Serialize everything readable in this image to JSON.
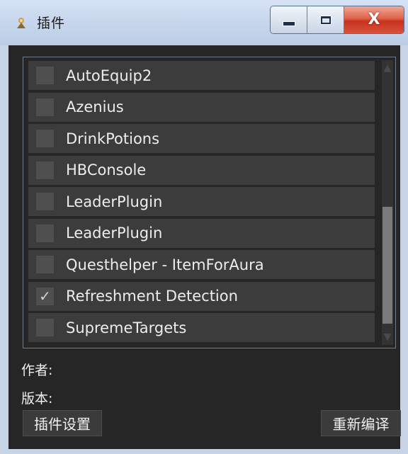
{
  "window": {
    "title": "插件",
    "close_label": "X"
  },
  "plugins": [
    {
      "label": "AutoEquip2",
      "checked": false
    },
    {
      "label": "Azenius",
      "checked": false
    },
    {
      "label": "DrinkPotions",
      "checked": false
    },
    {
      "label": "HBConsole",
      "checked": false
    },
    {
      "label": "LeaderPlugin",
      "checked": false
    },
    {
      "label": "LeaderPlugin",
      "checked": false
    },
    {
      "label": "Questhelper - ItemForAura",
      "checked": false
    },
    {
      "label": "Refreshment Detection",
      "checked": true
    },
    {
      "label": "SupremeTargets",
      "checked": false
    }
  ],
  "details": {
    "author_label": "作者:",
    "version_label": "版本:"
  },
  "buttons": {
    "settings_label": "插件设置",
    "recompile_label": "重新编译"
  },
  "colors": {
    "client_bg": "#262626",
    "item_bg": "#3c3c3c",
    "titlebar": "#c8d7ec",
    "close_button": "#d8533b"
  }
}
